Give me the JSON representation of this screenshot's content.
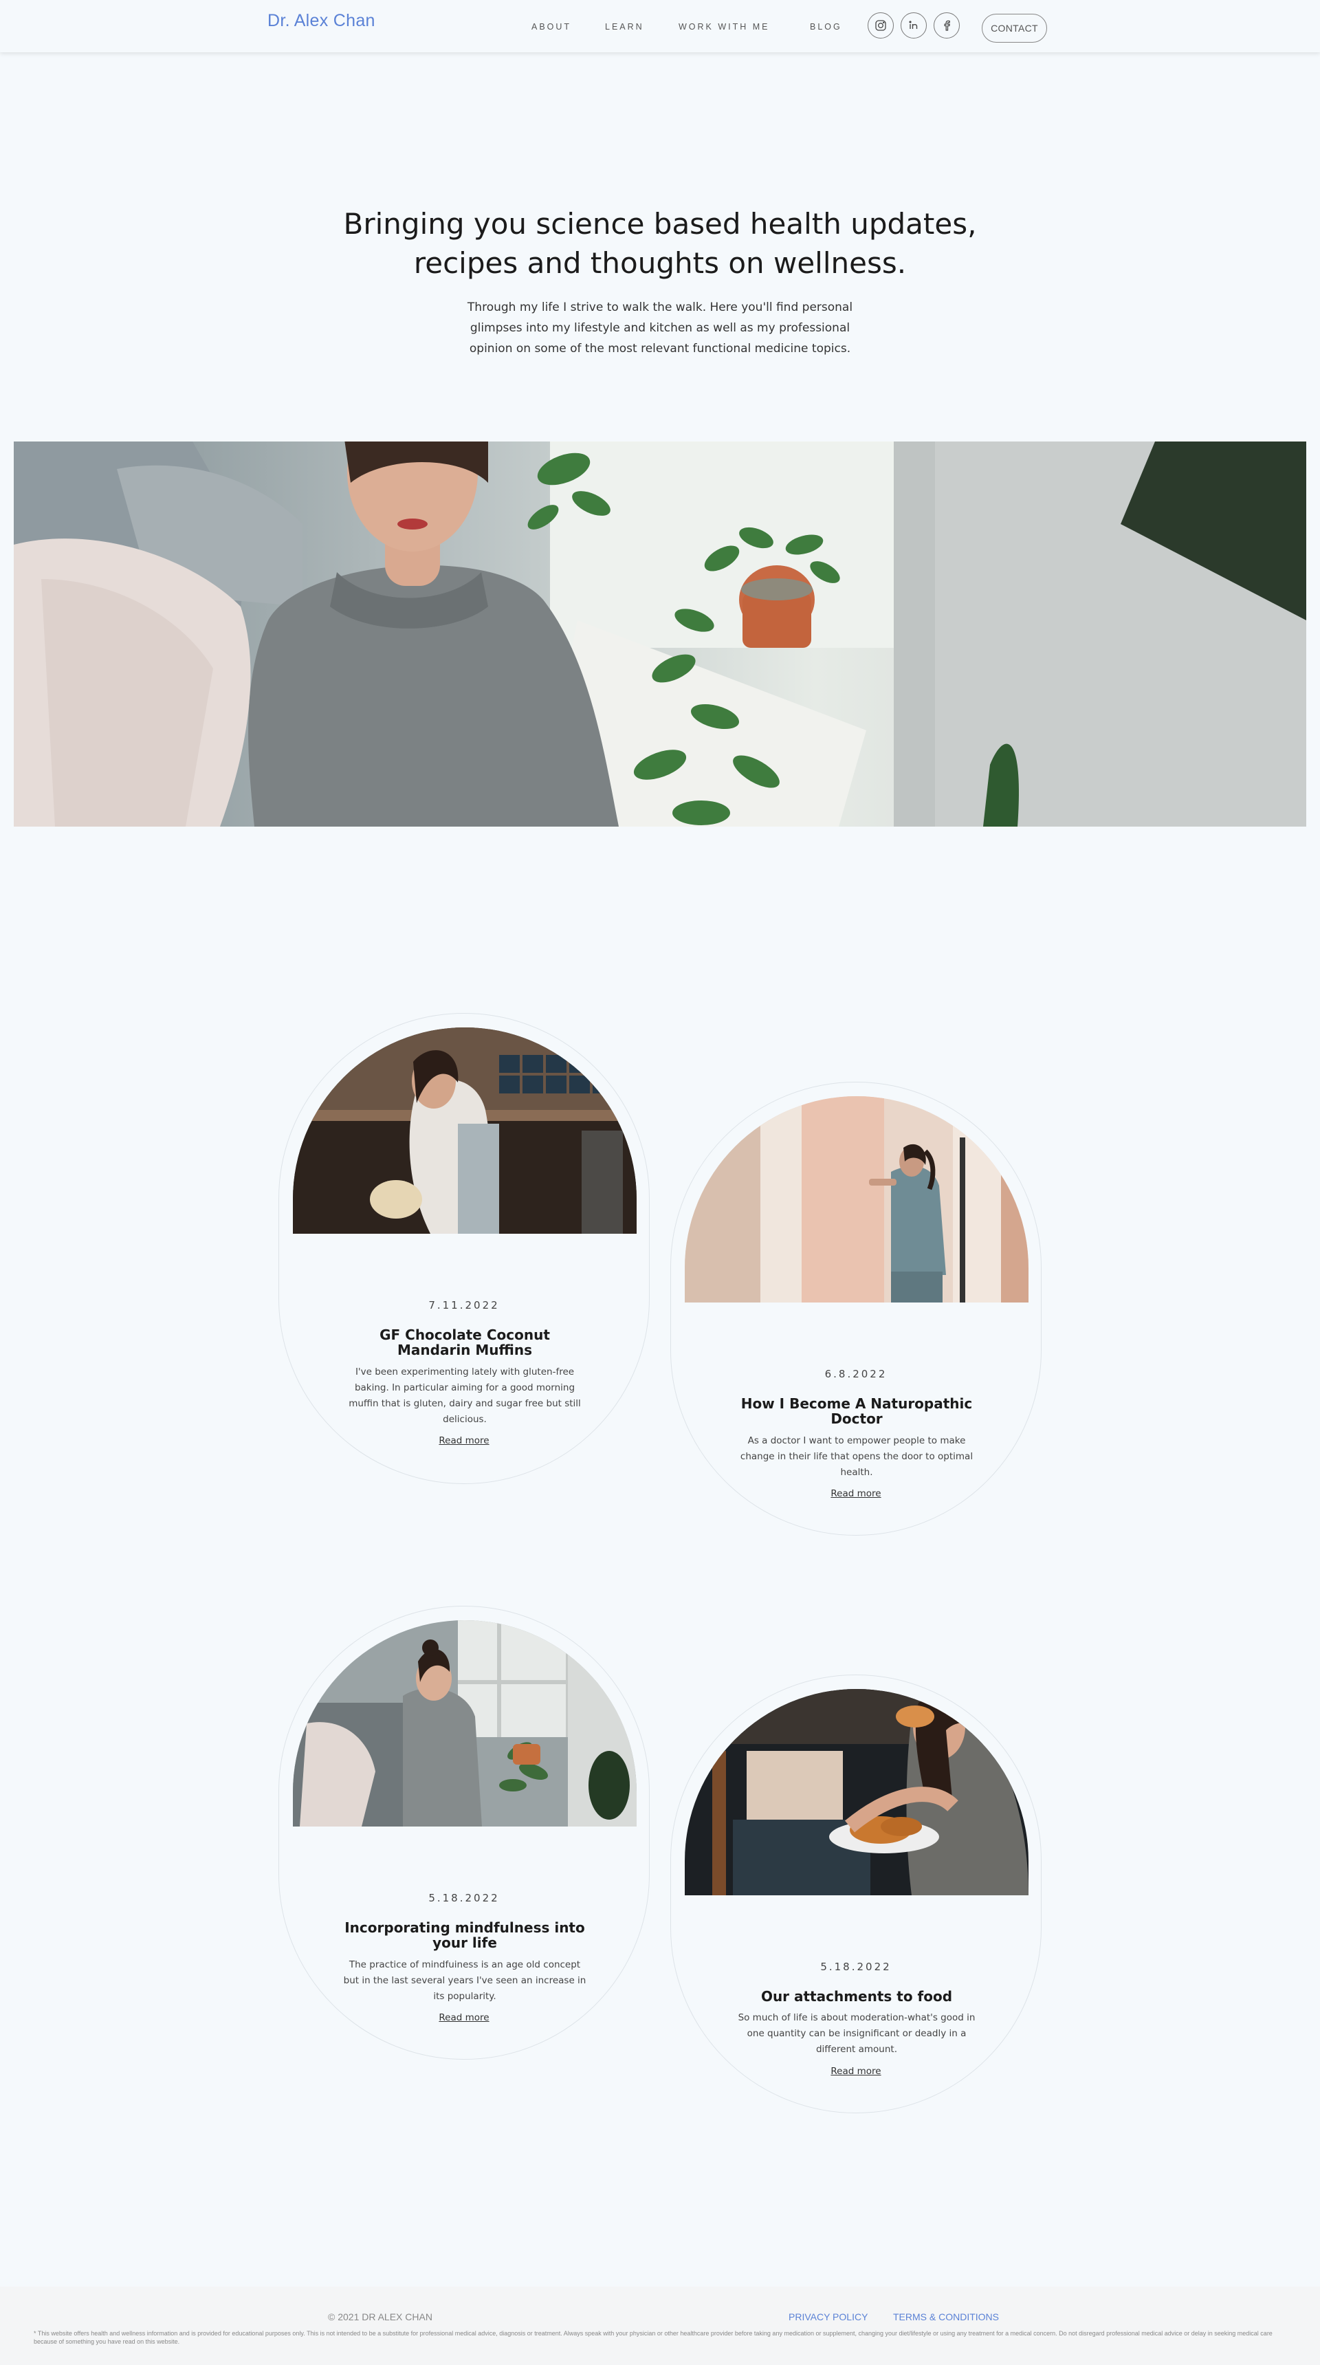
{
  "header": {
    "brand": "Dr. Alex Chan",
    "nav": [
      "ABOUT",
      "LEARN",
      "WORK WITH ME",
      "BLOG"
    ],
    "social_icons": [
      "instagram-icon",
      "linkedin-icon",
      "facebook-icon"
    ],
    "contact_label": "CONTACT"
  },
  "hero": {
    "title_line1": "Bringing you science based health updates,",
    "title_line2": "recipes and thoughts on wellness.",
    "subtitle_line1": "Through my life I strive to walk the walk. Here you'll find personal",
    "subtitle_line2": "glimpses into my lifestyle and kitchen as well as my professional",
    "subtitle_line3": "opinion on some of the most relevant functional medicine topics."
  },
  "posts": [
    {
      "date": "7.11.2022",
      "title": "GF Chocolate Coconut Mandarin Muffins",
      "excerpt": "I've been experimenting lately with gluten-free baking. In particular aiming for a good morning muffin that is gluten, dairy and sugar free but still delicious.",
      "read_more": "Read more"
    },
    {
      "date": "6.8.2022",
      "title": "How I Become A Naturopathic Doctor",
      "excerpt": "As a doctor I want to empower people to make change in their life that opens the door to optimal health.",
      "read_more": "Read more"
    },
    {
      "date": "5.18.2022",
      "title": "Incorporating mindfulness into your life",
      "excerpt": "The practice of mindfuiness is an age old concept but in the last several years I've seen an increase in its popularity.",
      "read_more": "Read more"
    },
    {
      "date": "5.18.2022",
      "title": "Our attachments to food",
      "excerpt": "So much of life is about moderation-what's good in one quantity can be insignificant or deadly in a different amount.",
      "read_more": "Read more"
    }
  ],
  "footer": {
    "copyright": "© 2021 DR ALEX CHAN",
    "privacy": "PRIVACY POLICY",
    "terms": "TERMS & CONDITIONS",
    "disclaimer": "* This website offers health and wellness information and is provided for educational purposes only. This is not intended to be a substitute for professional medical advice, diagnosis or treatment. Always speak with your physician or other healthcare provider before taking any medication or supplement, changing your diet/lifestyle or using any treatment for a medical concern. Do not disregard professional medical advice or delay in seeking medical care because of something you have read on this website."
  },
  "colors": {
    "background": "#f5f9fc",
    "brand": "#5b82d6",
    "footer_bg": "#f4f5f6"
  }
}
